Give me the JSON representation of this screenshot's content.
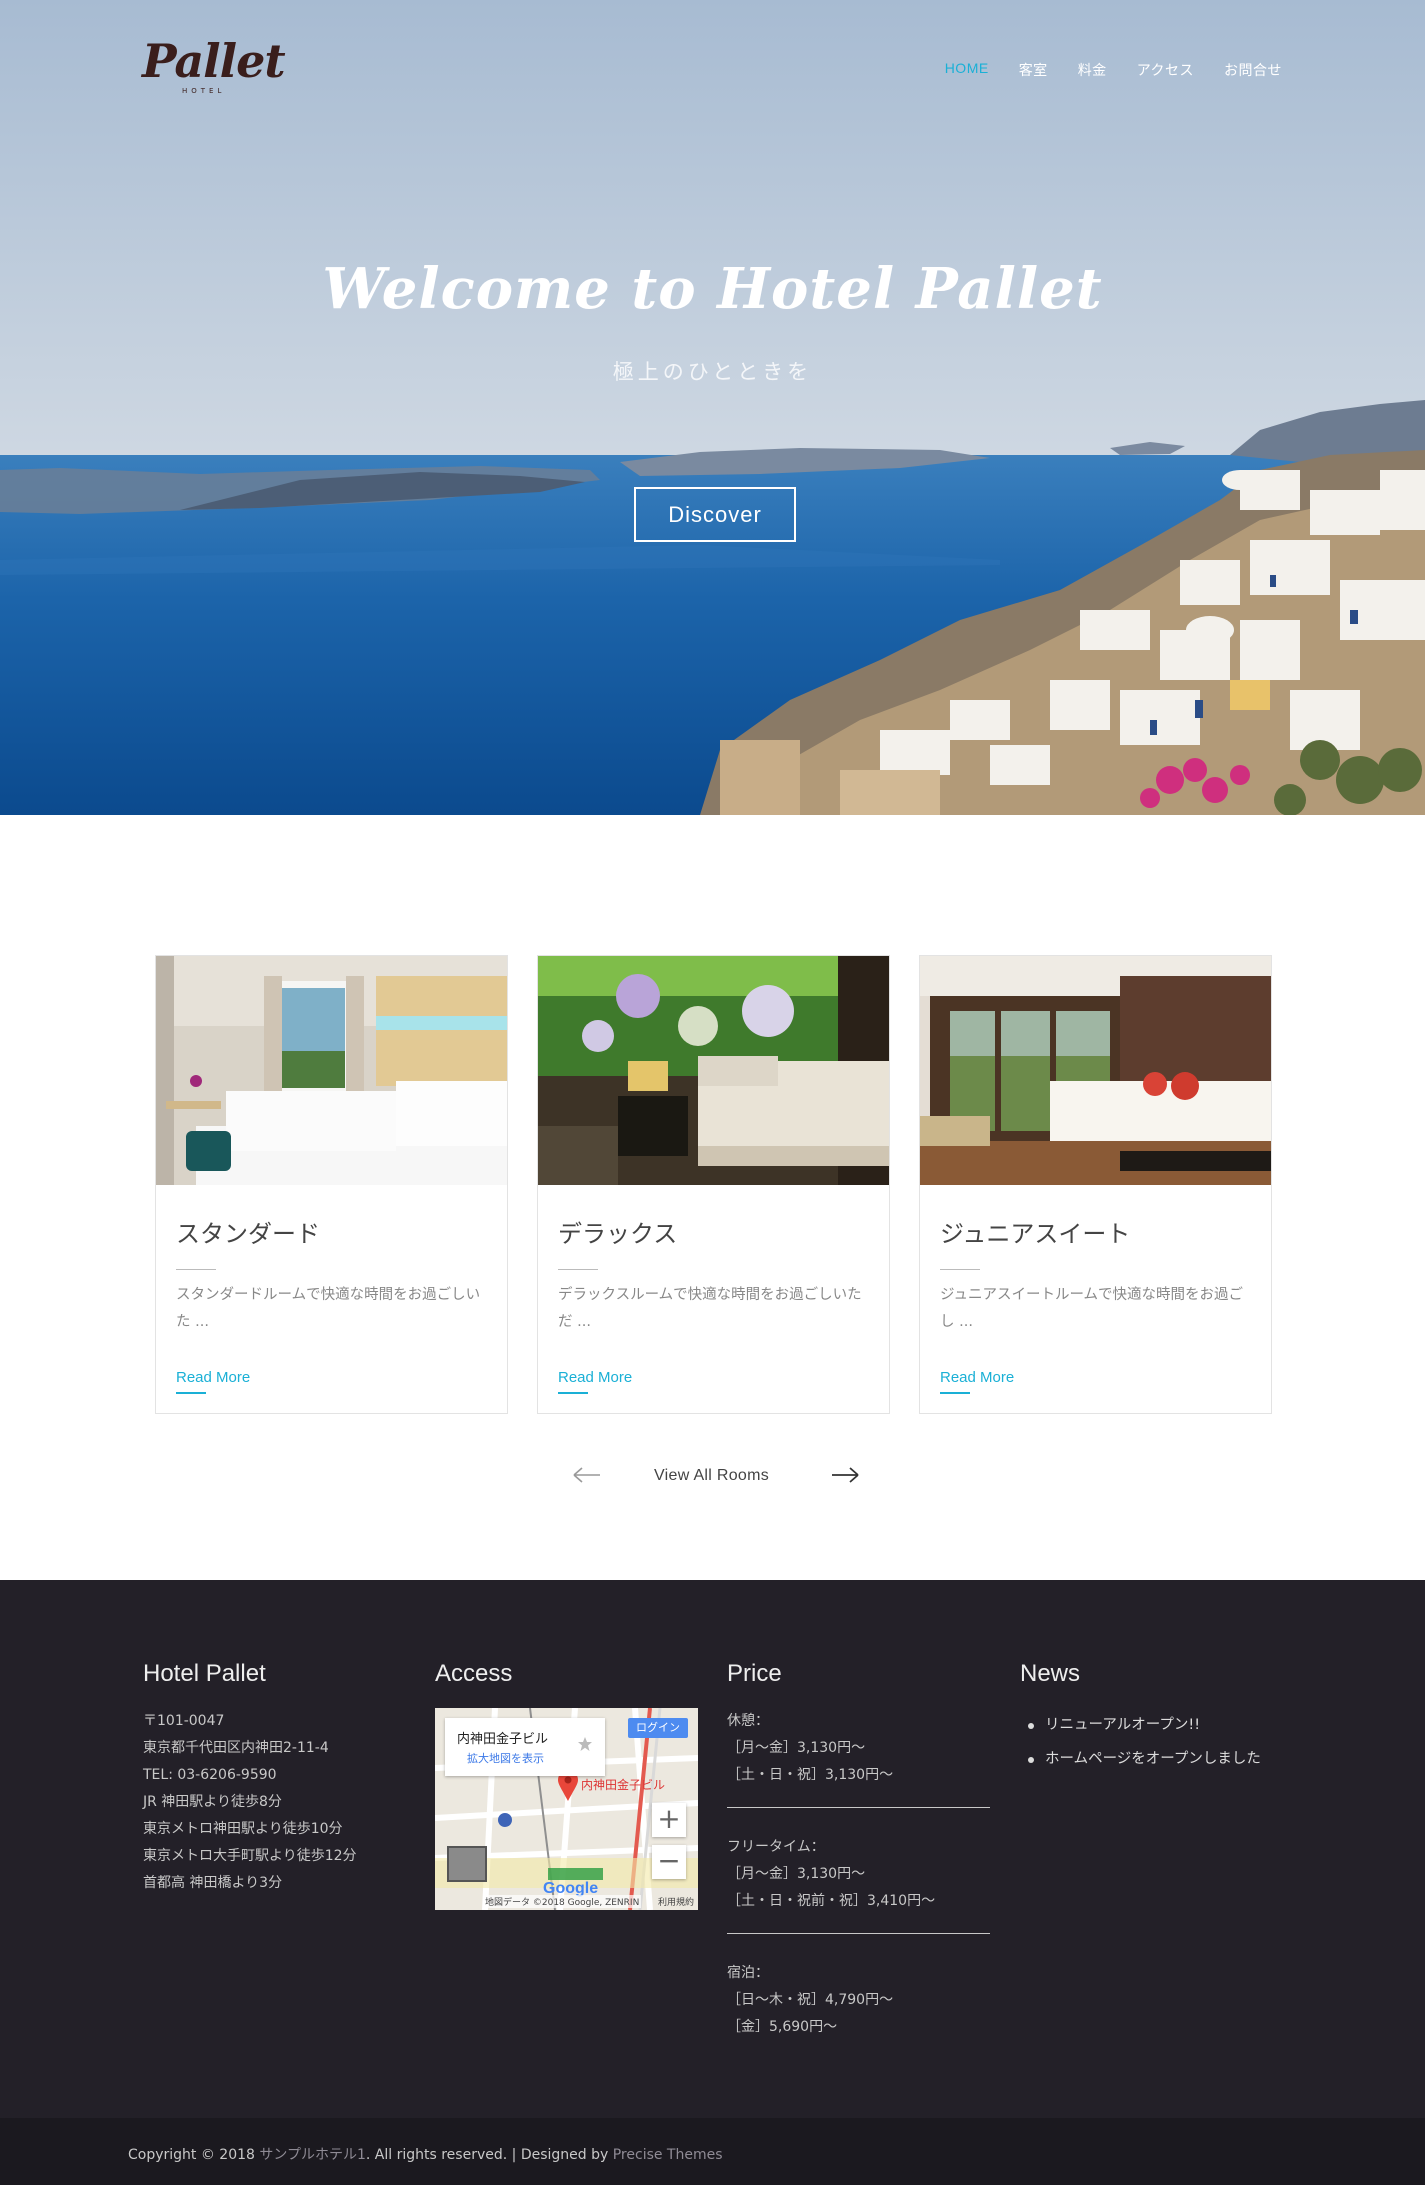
{
  "brand": {
    "logo_text": "Pallet",
    "logo_sub": "HOTEL"
  },
  "nav": [
    {
      "label": "HOME",
      "active": true
    },
    {
      "label": "客室",
      "active": false
    },
    {
      "label": "料金",
      "active": false
    },
    {
      "label": "アクセス",
      "active": false
    },
    {
      "label": "お問合せ",
      "active": false
    }
  ],
  "hero": {
    "title": "Welcome to Hotel Pallet",
    "subtitle": "極上のひとときを",
    "button": "Discover"
  },
  "rooms": [
    {
      "name": "スタンダード",
      "desc": "スタンダードルームで快適な時間をお過ごしいた ...",
      "more": "Read More"
    },
    {
      "name": "デラックス",
      "desc": "デラックスルームで快適な時間をお過ごしいただ ...",
      "more": "Read More"
    },
    {
      "name": "ジュニアスイート",
      "desc": "ジュニアスイートルームで快適な時間をお過ごし ...",
      "more": "Read More"
    }
  ],
  "pager": {
    "view_all": "View All Rooms"
  },
  "footer": {
    "about": {
      "title": "Hotel Pallet",
      "lines": [
        "〒101-0047",
        "東京都千代田区内神田2-11-4",
        "TEL: 03-6206-9590",
        "JR 神田駅より徒歩8分",
        "東京メトロ神田駅より徒歩10分",
        "東京メトロ大手町駅より徒歩12分",
        "首都高 神田橋より3分"
      ]
    },
    "access": {
      "title": "Access",
      "map": {
        "place": "内神田金子ビル",
        "link": "拡大地図を表示",
        "login": "ログイン",
        "pin_label": "内神田金子ビル",
        "credit": "地図データ ©2018 Google, ZENRIN",
        "terms": "利用規約",
        "brand": "Google"
      }
    },
    "price": {
      "title": "Price",
      "blocks": [
        {
          "label": "休憩：",
          "rows": [
            "［月〜金］3,130円〜",
            "［土・日・祝］3,130円〜"
          ]
        },
        {
          "label": "フリータイム：",
          "rows": [
            "［月〜金］3,130円〜",
            "［土・日・祝前・祝］3,410円〜"
          ]
        },
        {
          "label": "宿泊：",
          "rows": [
            "［日〜木・祝］4,790円〜",
            "［金］5,690円〜"
          ]
        }
      ]
    },
    "news": {
      "title": "News",
      "items": [
        "リニューアルオープン!!",
        "ホームページをオープンしました"
      ]
    }
  },
  "copyright": {
    "prefix": "Copyright © 2018 ",
    "site": "サンプルホテル1",
    "middle": ". All rights reserved. | Designed by ",
    "designer": "Precise Themes"
  },
  "colors": {
    "accent": "#1ab0d6",
    "footer_bg": "#232028",
    "copy_bg": "#1b191f"
  }
}
